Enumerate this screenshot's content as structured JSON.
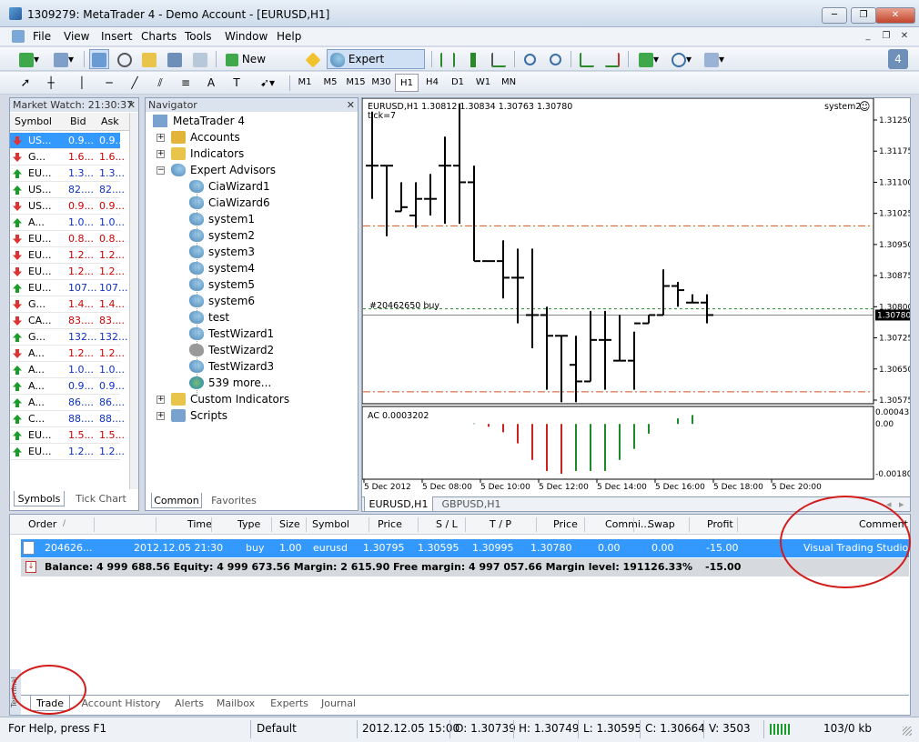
{
  "window": {
    "title": "1309279: MetaTrader 4 - Demo Account - [EURUSD,H1]",
    "minimize": "─",
    "restore": "❐",
    "close": "✕"
  },
  "menu": [
    "File",
    "View",
    "Insert",
    "Charts",
    "Tools",
    "Window",
    "Help"
  ],
  "toolbar": {
    "new_order": "New Order",
    "expert_advisors": "Expert Advisors",
    "badge": "4"
  },
  "timeframes": [
    "M1",
    "M5",
    "M15",
    "M30",
    "H1",
    "H4",
    "D1",
    "W1",
    "MN"
  ],
  "active_timeframe": "H1",
  "market_watch": {
    "title": "Market Watch: 21:30:37",
    "headers": {
      "symbol": "Symbol",
      "bid": "Bid",
      "ask": "Ask"
    },
    "rows": [
      {
        "dir": "dn",
        "symbol": "US...",
        "bid": "0.9...",
        "ask": "0.9...",
        "color": "white"
      },
      {
        "dir": "dn",
        "symbol": "G...",
        "bid": "1.6...",
        "ask": "1.6...",
        "color": "red"
      },
      {
        "dir": "up",
        "symbol": "EU...",
        "bid": "1.3...",
        "ask": "1.3...",
        "color": "blue"
      },
      {
        "dir": "up",
        "symbol": "US...",
        "bid": "82....",
        "ask": "82....",
        "color": "blue"
      },
      {
        "dir": "dn",
        "symbol": "US...",
        "bid": "0.9...",
        "ask": "0.9...",
        "color": "red"
      },
      {
        "dir": "up",
        "symbol": "A...",
        "bid": "1.0...",
        "ask": "1.0...",
        "color": "blue"
      },
      {
        "dir": "dn",
        "symbol": "EU...",
        "bid": "0.8...",
        "ask": "0.8...",
        "color": "red"
      },
      {
        "dir": "dn",
        "symbol": "EU...",
        "bid": "1.2...",
        "ask": "1.2...",
        "color": "red"
      },
      {
        "dir": "dn",
        "symbol": "EU...",
        "bid": "1.2...",
        "ask": "1.2...",
        "color": "red"
      },
      {
        "dir": "up",
        "symbol": "EU...",
        "bid": "107....",
        "ask": "107....",
        "color": "blue"
      },
      {
        "dir": "dn",
        "symbol": "G...",
        "bid": "1.4...",
        "ask": "1.4...",
        "color": "red"
      },
      {
        "dir": "dn",
        "symbol": "CA...",
        "bid": "83....",
        "ask": "83....",
        "color": "red"
      },
      {
        "dir": "up",
        "symbol": "G...",
        "bid": "132....",
        "ask": "132....",
        "color": "blue"
      },
      {
        "dir": "dn",
        "symbol": "A...",
        "bid": "1.2...",
        "ask": "1.2...",
        "color": "red"
      },
      {
        "dir": "up",
        "symbol": "A...",
        "bid": "1.0...",
        "ask": "1.0...",
        "color": "blue"
      },
      {
        "dir": "up",
        "symbol": "A...",
        "bid": "0.9...",
        "ask": "0.9...",
        "color": "blue"
      },
      {
        "dir": "up",
        "symbol": "A...",
        "bid": "86....",
        "ask": "86....",
        "color": "blue"
      },
      {
        "dir": "up",
        "symbol": "C...",
        "bid": "88....",
        "ask": "88....",
        "color": "blue"
      },
      {
        "dir": "up",
        "symbol": "EU...",
        "bid": "1.5...",
        "ask": "1.5...",
        "color": "red"
      },
      {
        "dir": "up",
        "symbol": "EU...",
        "bid": "1.2...",
        "ask": "1.2...",
        "color": "blue"
      }
    ],
    "tabs": [
      "Symbols",
      "Tick Chart"
    ]
  },
  "navigator": {
    "title": "Navigator",
    "root": "MetaTrader 4",
    "items": [
      {
        "label": "Accounts",
        "level": 1,
        "icon": "accounts-icon",
        "expand": "+"
      },
      {
        "label": "Indicators",
        "level": 1,
        "icon": "indicators-icon",
        "expand": "+"
      },
      {
        "label": "Expert Advisors",
        "level": 1,
        "icon": "expert-icon",
        "expand": "−"
      },
      {
        "label": "CiaWizard1",
        "level": 2,
        "icon": "expert-icon"
      },
      {
        "label": "CiaWizard6",
        "level": 2,
        "icon": "expert-icon"
      },
      {
        "label": "system1",
        "level": 2,
        "icon": "expert-icon"
      },
      {
        "label": "system2",
        "level": 2,
        "icon": "expert-icon"
      },
      {
        "label": "system3",
        "level": 2,
        "icon": "expert-icon"
      },
      {
        "label": "system4",
        "level": 2,
        "icon": "expert-icon"
      },
      {
        "label": "system5",
        "level": 2,
        "icon": "expert-icon"
      },
      {
        "label": "system6",
        "level": 2,
        "icon": "expert-icon"
      },
      {
        "label": "test",
        "level": 2,
        "icon": "expert-icon"
      },
      {
        "label": "TestWizard1",
        "level": 2,
        "icon": "expert-icon"
      },
      {
        "label": "TestWizard2",
        "level": 2,
        "icon": "expert-gray-icon"
      },
      {
        "label": "TestWizard3",
        "level": 2,
        "icon": "expert-icon"
      },
      {
        "label": "539 more...",
        "level": 2,
        "icon": "globe-icon"
      },
      {
        "label": "Custom Indicators",
        "level": 1,
        "icon": "custom-indicators-icon",
        "expand": "+"
      },
      {
        "label": "Scripts",
        "level": 1,
        "icon": "scripts-icon",
        "expand": "+"
      }
    ],
    "tabs": [
      "Common",
      "Favorites"
    ]
  },
  "chart": {
    "header": "EURUSD,H1  1.30812 1.30834 1.30763 1.30780",
    "tick": "tick=7",
    "ea_label": "system2",
    "order_label": "#20462650 buy",
    "current_price": "1.30780",
    "price_ticks": [
      "1.31250",
      "1.31175",
      "1.31100",
      "1.31025",
      "1.30950",
      "1.30875",
      "1.30800",
      "1.30725",
      "1.30650",
      "1.30575"
    ],
    "indicator_label": "AC 0.0003202",
    "indicator_ticks": [
      "0.000435",
      "0.00",
      "-0.00180"
    ],
    "time_ticks": [
      "5 Dec 2012",
      "5 Dec 08:00",
      "5 Dec 10:00",
      "5 Dec 12:00",
      "5 Dec 14:00",
      "5 Dec 16:00",
      "5 Dec 18:00",
      "5 Dec 20:00"
    ],
    "tabs": [
      "EURUSD,H1",
      "GBPUSD,H1"
    ]
  },
  "chart_data": {
    "type": "ohlc",
    "title": "EURUSD,H1",
    "ylim": [
      1.3057,
      1.3128
    ],
    "bars": [
      [
        1.3114,
        1.3127,
        1.3106,
        1.3114
      ],
      [
        1.3114,
        1.3114,
        1.3097,
        1.3114
      ],
      [
        1.3103,
        1.311,
        1.3103,
        1.3104
      ],
      [
        1.3102,
        1.311,
        1.3099,
        1.3106
      ],
      [
        1.3106,
        1.3112,
        1.3102,
        1.3106
      ],
      [
        1.3114,
        1.3121,
        1.31,
        1.3114
      ],
      [
        1.3114,
        1.3129,
        1.31,
        1.311
      ],
      [
        1.311,
        1.3114,
        1.3091,
        1.3091
      ],
      [
        1.3091,
        1.3091,
        1.3091,
        1.3091
      ],
      [
        1.3091,
        1.3096,
        1.3082,
        1.3087
      ],
      [
        1.3087,
        1.3094,
        1.3076,
        1.3087
      ],
      [
        1.3078,
        1.3094,
        1.307,
        1.3078
      ],
      [
        1.3078,
        1.308,
        1.306,
        1.3073
      ],
      [
        1.3073,
        1.3073,
        1.3057,
        1.3073
      ],
      [
        1.3066,
        1.3073,
        1.3057,
        1.3062
      ],
      [
        1.3062,
        1.3079,
        1.3062,
        1.3072
      ],
      [
        1.3072,
        1.3079,
        1.306,
        1.3072
      ],
      [
        1.3067,
        1.3078,
        1.3067,
        1.3067
      ],
      [
        1.3067,
        1.3074,
        1.306,
        1.3076
      ],
      [
        1.3076,
        1.3078,
        1.3076,
        1.3078
      ],
      [
        1.3078,
        1.3089,
        1.3078,
        1.3085
      ],
      [
        1.3085,
        1.3086,
        1.308,
        1.3084
      ],
      [
        1.3081,
        1.3083,
        1.3081,
        1.3081
      ],
      [
        1.3081,
        1.3083,
        1.3076,
        1.3078
      ]
    ],
    "lines": {
      "stop_loss": 1.30595,
      "take_profit": 1.30995,
      "order_price": 1.30795
    },
    "indicator": {
      "name": "AC",
      "ylim": [
        -0.0018,
        0.000435
      ],
      "values": [
        0,
        0,
        0,
        0,
        0,
        0,
        0,
        2e-05,
        -0.0001,
        -0.0003,
        -0.0007,
        -0.0013,
        -0.0017,
        -0.0018,
        -0.0017,
        -0.0017,
        -0.0017,
        -0.0013,
        -0.0009,
        -0.00035,
        0.0,
        0.0002,
        0.0003202,
        0
      ]
    }
  },
  "terminal": {
    "headers": [
      "Order",
      "Time",
      "Type",
      "Size",
      "Symbol",
      "Price",
      "S / L",
      "T / P",
      "Price",
      "Commi...",
      "Swap",
      "Profit",
      "Comment"
    ],
    "sort_indicator": "/",
    "order": [
      "204626...",
      "2012.12.05 21:30",
      "buy",
      "1.00",
      "eurusd",
      "1.30795",
      "1.30595",
      "1.30995",
      "1.30780",
      "0.00",
      "0.00",
      "-15.00",
      "Visual Trading Studio"
    ],
    "summary": "Balance: 4 999 688.56  Equity: 4 999 673.56  Margin: 2 615.90  Free margin: 4 997 057.66  Margin level: 191126.33%",
    "summary_profit": "-15.00",
    "tabs": [
      "Trade",
      "Account History",
      "Alerts",
      "Mailbox",
      "Experts",
      "Journal"
    ],
    "side_label": "Terminal"
  },
  "status": {
    "help": "For Help, press F1",
    "profile": "Default",
    "time": "2012.12.05 15:00",
    "open": "O: 1.30739",
    "high": "H: 1.30749",
    "low": "L: 1.30595",
    "close": "C: 1.30664",
    "volume": "V: 3503",
    "traffic": "103/0 kb"
  },
  "colors": {
    "selection": "#3399ff",
    "annotation": "#d31c1c",
    "bull": "#1a9c2a",
    "bear": "#d33333"
  }
}
